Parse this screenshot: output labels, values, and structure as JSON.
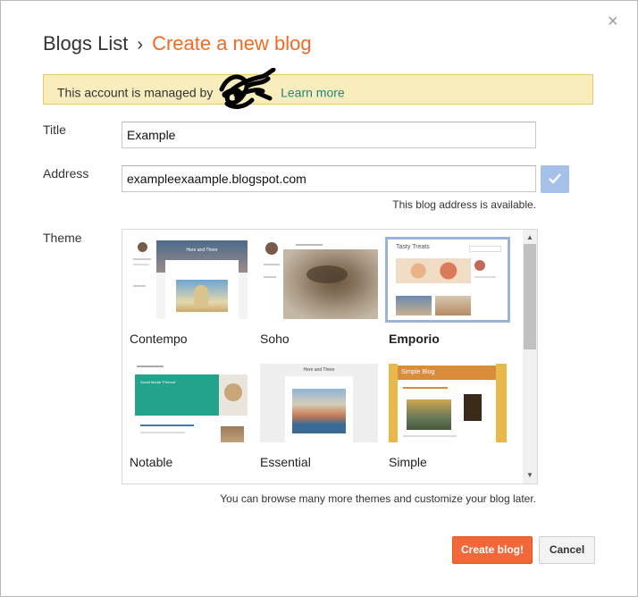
{
  "dialog": {
    "close_glyph": "×",
    "breadcrumb": {
      "root": "Blogs List",
      "separator": "›",
      "current": "Create a new blog"
    },
    "notice": {
      "text": "This account is managed by",
      "link": "Learn more"
    },
    "form": {
      "title_label": "Title",
      "title_value": "Example",
      "address_label": "Address",
      "address_value": "exampleexaample.blogspot.com",
      "address_status": "This blog address is available.",
      "theme_label": "Theme"
    },
    "themes": [
      {
        "name": "Contempo",
        "selected": false
      },
      {
        "name": "Soho",
        "selected": false
      },
      {
        "name": "Emporio",
        "selected": true
      },
      {
        "name": "Notable",
        "selected": false
      },
      {
        "name": "Essential",
        "selected": false
      },
      {
        "name": "Simple",
        "selected": false
      }
    ],
    "thumb_text": {
      "contempo": "Here and There",
      "emporio": "Tasty Treats",
      "notable": "Social Media \"Friends\"",
      "essential": "Here and There",
      "simple": "Simple Blog"
    },
    "hint": "You can browse many more themes and customize your blog later.",
    "buttons": {
      "create": "Create blog!",
      "cancel": "Cancel"
    },
    "colors": {
      "accent": "#f26b21",
      "notice_bg": "#f9edbe",
      "link": "#1a8a7a",
      "check": "#a5c1ea",
      "create_btn": "#f3683a"
    },
    "icons": {
      "close": "close-icon",
      "check": "check-icon",
      "scroll_up": "scroll-up-arrow-icon",
      "scroll_down": "scroll-down-arrow-icon"
    }
  }
}
